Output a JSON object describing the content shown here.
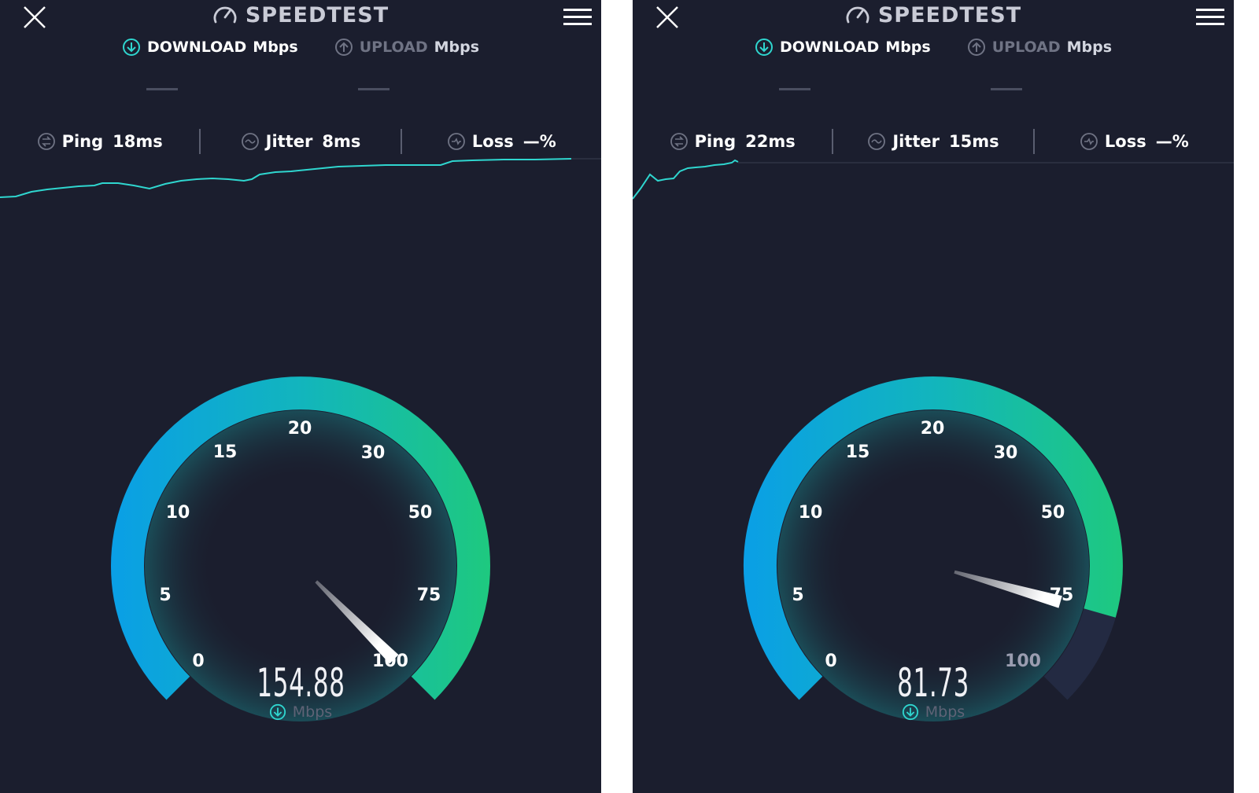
{
  "app": {
    "title": "SPEEDTEST"
  },
  "colors": {
    "background": "#1b1e2e",
    "accent": "#2fd6cf",
    "gauge_start": "#0a9fe6",
    "gauge_end": "#1ec97f",
    "muted": "#6f7384"
  },
  "icons": {
    "close": "close-icon",
    "menu": "hamburger-menu-icon",
    "logo": "speedometer-icon",
    "download": "download-arrow-icon",
    "upload": "upload-arrow-icon",
    "ping": "ping-icon",
    "jitter": "jitter-icon",
    "loss": "loss-icon"
  },
  "gauge_scale": [
    "0",
    "5",
    "10",
    "15",
    "20",
    "30",
    "50",
    "75",
    "100"
  ],
  "panels": [
    {
      "tabs": {
        "download_label": "DOWNLOAD",
        "download_unit": "Mbps",
        "upload_label": "UPLOAD",
        "upload_unit": "Mbps"
      },
      "stats": {
        "ping_label": "Ping",
        "ping_value": "18ms",
        "jitter_label": "Jitter",
        "jitter_value": "8ms",
        "loss_label": "Loss",
        "loss_value": "—%"
      },
      "speed": {
        "value": "154.88",
        "unit": "Mbps"
      },
      "gauge_fill_fraction": 1.0,
      "needle_scale_fraction": 1.0
    },
    {
      "tabs": {
        "download_label": "DOWNLOAD",
        "download_unit": "Mbps",
        "upload_label": "UPLOAD",
        "upload_unit": "Mbps"
      },
      "stats": {
        "ping_label": "Ping",
        "ping_value": "22ms",
        "jitter_label": "Jitter",
        "jitter_value": "15ms",
        "loss_label": "Loss",
        "loss_value": "—%"
      },
      "speed": {
        "value": "81.73",
        "unit": "Mbps"
      },
      "gauge_fill_fraction": 0.892,
      "needle_scale_fraction": 0.892
    }
  ]
}
